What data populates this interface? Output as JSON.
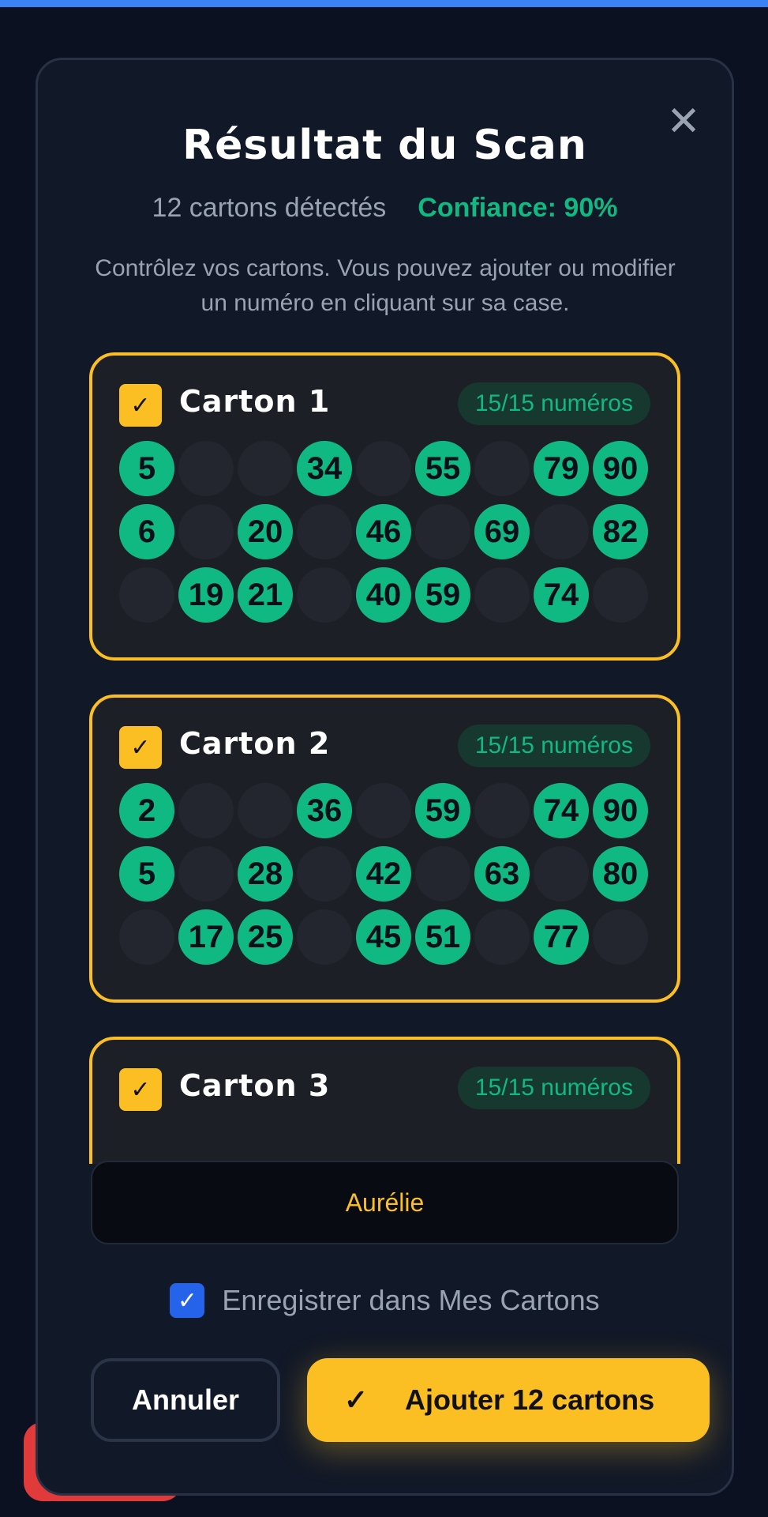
{
  "modal": {
    "close_glyph": "✕",
    "title": "Résultat du Scan",
    "count_text": "12 cartons détectés",
    "confidence_text": "Confiance: 90%",
    "hint": "Contrôlez vos cartons. Vous pouvez ajouter ou modifier un numéro en cliquant sur sa case."
  },
  "cards": [
    {
      "title": "Carton 1",
      "badge": "15/15 numéros",
      "rows": [
        [
          "5",
          "",
          "",
          "34",
          "",
          "55",
          "",
          "79",
          "90"
        ],
        [
          "6",
          "",
          "20",
          "",
          "46",
          "",
          "69",
          "",
          "82"
        ],
        [
          "",
          "19",
          "21",
          "",
          "40",
          "59",
          "",
          "74",
          ""
        ]
      ]
    },
    {
      "title": "Carton 2",
      "badge": "15/15 numéros",
      "rows": [
        [
          "2",
          "",
          "",
          "36",
          "",
          "59",
          "",
          "74",
          "90"
        ],
        [
          "5",
          "",
          "28",
          "",
          "42",
          "",
          "63",
          "",
          "80"
        ],
        [
          "",
          "17",
          "25",
          "",
          "45",
          "51",
          "",
          "77",
          ""
        ]
      ]
    },
    {
      "title": "Carton 3",
      "badge": "15/15 numéros",
      "rows": []
    }
  ],
  "player": {
    "name_value": "Aurélie"
  },
  "save": {
    "label": "Enregistrer dans Mes Cartons",
    "checked": true
  },
  "actions": {
    "cancel_label": "Annuler",
    "add_label": "Ajouter 12 cartons"
  },
  "colors": {
    "accent": "#fbbf24",
    "number_bg": "#10b981",
    "confidence": "#10b981",
    "checkbox_blue": "#2563eb"
  }
}
